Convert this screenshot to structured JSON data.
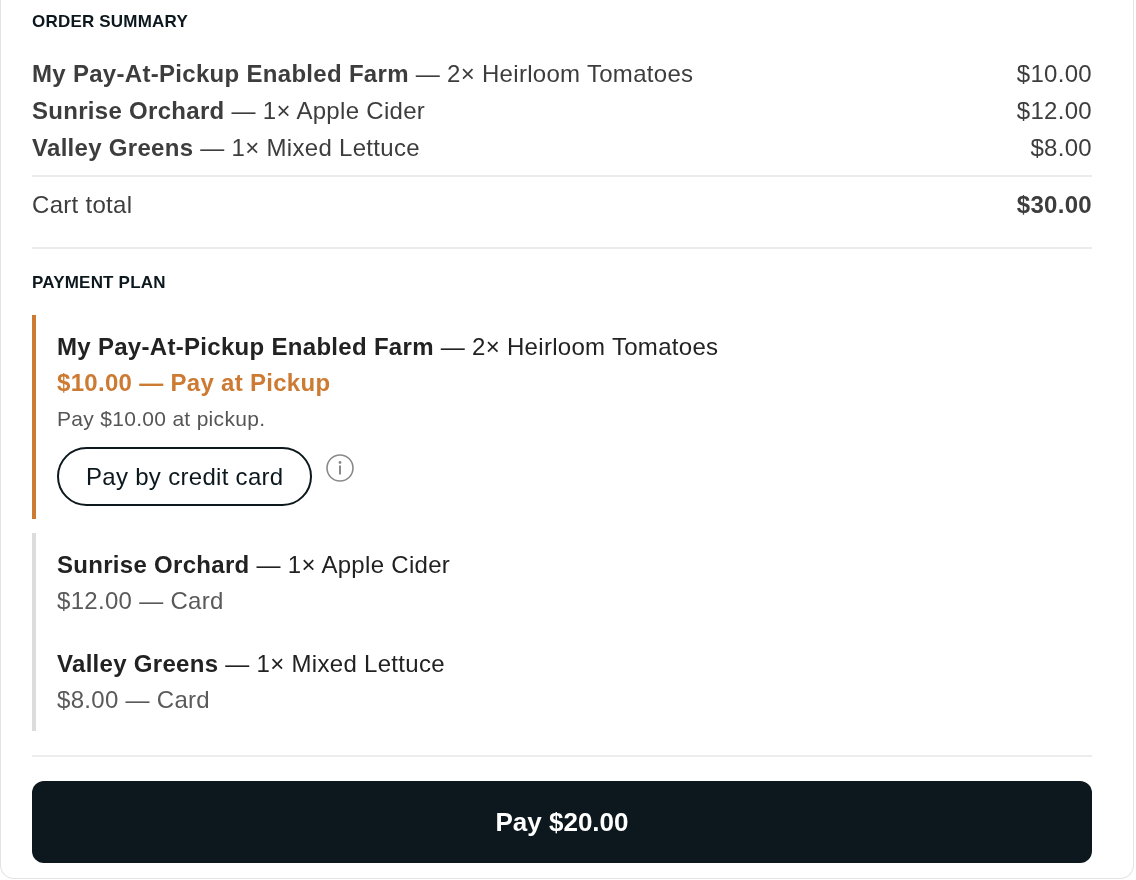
{
  "order_summary": {
    "heading": "ORDER SUMMARY",
    "items": [
      {
        "text": "**My Pay-At-Pickup Enabled Farm** — 2× Heirloom Tomatoes",
        "price": "$10.00"
      },
      {
        "text": "**Sunrise Orchard** — 1× Apple Cider",
        "price": "$12.00"
      },
      {
        "text": "**Valley Greens** — 1× Mixed Lettuce",
        "price": "$8.00"
      }
    ],
    "total": {
      "label": "Cart total",
      "value": "$30.00"
    }
  },
  "payment_plan": {
    "heading": "PAYMENT PLAN",
    "items": [
      {
        "kind": "pickup",
        "text": "**My Pay-At-Pickup Enabled Farm** — 2× Heirloom Tomatoes",
        "status": "$10.00 — Pay at Pickup",
        "note": "Pay $10.00 at pickup.",
        "button": "Pay by credit card"
      },
      {
        "kind": "card",
        "text": "**Sunrise Orchard** — 1× Apple Cider",
        "status": "$12.00 — Card"
      },
      {
        "kind": "card",
        "text": "**Valley Greens** — 1× Mixed Lettuce",
        "status": "$8.00 — Card"
      }
    ]
  },
  "pay_button": "Pay $20.00"
}
